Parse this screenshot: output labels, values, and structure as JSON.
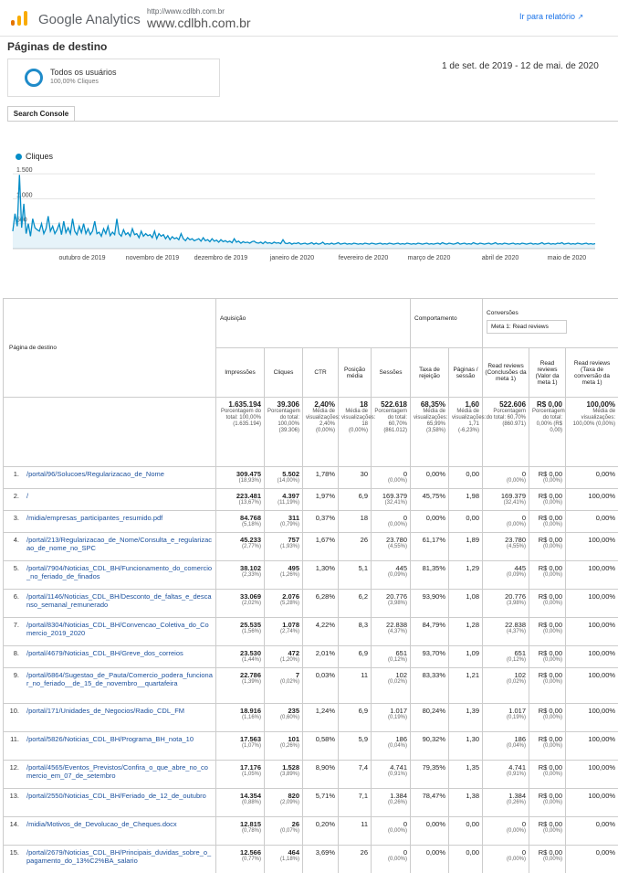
{
  "header": {
    "product": "Google Analytics",
    "site_small": "http://www.cdlbh.com.br",
    "site_big": "www.cdlbh.com.br",
    "report_link": "Ir para relatório",
    "brand_colors": [
      "#f9ab00",
      "#e37400"
    ]
  },
  "page_title": "Páginas de destino",
  "segment": {
    "name": "Todos os usuários",
    "pct": "100,00% Cliques"
  },
  "date_range": "1 de set. de 2019 - 12 de mai. de 2020",
  "tab": "Search Console",
  "chart_data": {
    "type": "line",
    "series": [
      {
        "name": "Cliques",
        "color": "#058dc7",
        "values": [
          350,
          700,
          450,
          1480,
          420,
          900,
          300,
          500,
          250,
          600,
          420,
          380,
          350,
          500,
          300,
          400,
          650,
          350,
          450,
          300,
          380,
          500,
          280,
          550,
          320,
          420,
          300,
          600,
          350,
          280,
          450,
          320,
          500,
          300,
          400,
          280,
          350,
          550,
          300,
          330,
          250,
          400,
          300,
          450,
          260,
          330,
          280,
          600,
          300,
          250,
          380,
          280,
          320,
          250,
          400,
          280,
          300,
          220,
          350,
          250,
          300,
          260,
          280,
          220,
          350,
          200,
          300,
          250,
          280,
          200,
          260,
          180,
          240,
          200,
          220,
          180,
          300,
          200,
          160,
          220,
          180,
          200,
          160,
          180,
          200,
          150,
          220,
          160,
          180,
          140,
          200,
          150,
          170,
          130,
          180,
          140,
          160,
          130,
          150,
          120,
          200,
          130,
          150,
          110,
          140,
          120,
          130,
          110,
          140,
          150,
          120,
          110,
          130,
          100,
          140,
          110,
          120,
          100,
          130,
          110,
          120,
          100,
          180,
          110,
          100,
          120,
          90,
          110,
          100,
          120,
          90,
          100,
          110,
          90,
          100,
          120,
          90,
          110,
          90,
          100,
          130,
          90,
          100,
          90,
          110,
          90,
          100,
          120,
          90,
          100,
          110,
          90,
          100,
          90,
          110,
          100,
          90,
          100,
          90,
          110,
          100,
          90,
          110,
          100,
          90,
          100,
          110,
          90,
          100,
          90,
          110,
          100,
          90,
          100,
          110,
          90,
          100,
          90,
          110,
          100,
          90,
          100,
          90,
          110,
          100,
          90,
          100,
          110,
          90,
          100,
          90,
          100,
          110,
          90,
          120,
          100,
          90,
          110,
          100,
          90,
          100,
          120,
          90,
          100,
          110,
          90,
          100,
          90,
          120,
          100,
          90,
          110,
          100,
          90,
          100,
          110,
          90,
          100,
          120,
          90,
          100,
          90,
          110,
          100,
          90,
          100,
          110,
          90,
          100,
          90,
          110,
          100,
          90,
          100,
          110,
          90,
          100,
          90,
          100,
          120,
          90,
          100,
          110,
          90,
          100,
          90,
          110,
          100,
          120,
          90,
          100,
          110,
          90,
          100,
          90,
          110,
          100,
          90,
          100,
          110,
          90,
          100,
          90,
          100
        ]
      }
    ],
    "y_ticks": [
      "1.500",
      "1.000",
      "500"
    ],
    "ylim": [
      0,
      1650
    ],
    "x_ticks": [
      "outubro de 2019",
      "novembro de 2019",
      "dezembro de 2019",
      "janeiro de 2020",
      "fevereiro de 2020",
      "março de 2020",
      "abril de 2020",
      "maio de 2020"
    ]
  },
  "table": {
    "dim_header": "Página de destino",
    "groups": {
      "acq": "Aquisição",
      "beh": "Comportamento",
      "conv": "Conversões",
      "conv_select": "Meta 1: Read reviews"
    },
    "metrics": [
      "Impressões",
      "Cliques",
      "CTR",
      "Posição média",
      "Sessões",
      "Taxa de rejeição",
      "Páginas / sessão",
      "Read reviews (Conclusões da meta 1)",
      "Read reviews (Valor da meta 1)",
      "Read reviews (Taxa de conversão da meta 1)"
    ],
    "totals": [
      {
        "big": "1.635.194",
        "sm": "Porcentagem do total: 100,00% (1.635.194)"
      },
      {
        "big": "39.306",
        "sm": "Porcentagem do total: 100,00% (39.306)"
      },
      {
        "big": "2,40%",
        "sm": "Média de visualizações: 2,40% (0,00%)"
      },
      {
        "big": "18",
        "sm": "Média de visualizações: 18 (0,00%)"
      },
      {
        "big": "522.618",
        "sm": "Porcentagem do total: 60,70% (861.012)"
      },
      {
        "big": "68,35%",
        "sm": "Média de visualizações: 65,99% (3,58%)"
      },
      {
        "big": "1,60",
        "sm": "Média de visualizações: 1,71 (-6,23%)"
      },
      {
        "big": "522.606",
        "sm": "Porcentagem do total: 60,70% (860.971)"
      },
      {
        "big": "R$ 0,00",
        "sm": "Porcentagem do total: 0,00% (R$ 0,00)"
      },
      {
        "big": "100,00%",
        "sm": "Média de visualizações: 100,00% (0,00%)"
      }
    ],
    "rows": [
      {
        "n": "1.",
        "page": "/portal/96/Solucoes/Regularizacao_de_Nome",
        "imp": "309.475",
        "imp_p": "(18,93%)",
        "cli": "5.502",
        "cli_p": "(14,00%)",
        "ctr": "1,78%",
        "pos": "30",
        "ses": "0",
        "ses_p": "(0,00%)",
        "rej": "0,00%",
        "pag": "0,00",
        "rr": "0",
        "rr_p": "(0,00%)",
        "val": "R$ 0,00",
        "val_p": "(0,00%)",
        "tx": "0,00%"
      },
      {
        "n": "2.",
        "page": "/",
        "imp": "223.481",
        "imp_p": "(13,67%)",
        "cli": "4.397",
        "cli_p": "(11,19%)",
        "ctr": "1,97%",
        "pos": "6,9",
        "ses": "169.379",
        "ses_p": "(32,41%)",
        "rej": "45,75%",
        "pag": "1,98",
        "rr": "169.379",
        "rr_p": "(32,41%)",
        "val": "R$ 0,00",
        "val_p": "(0,00%)",
        "tx": "100,00%"
      },
      {
        "n": "3.",
        "page": "/midia/empresas_participantes_resumido.pdf",
        "imp": "84.768",
        "imp_p": "(5,18%)",
        "cli": "311",
        "cli_p": "(0,79%)",
        "ctr": "0,37%",
        "pos": "18",
        "ses": "0",
        "ses_p": "(0,00%)",
        "rej": "0,00%",
        "pag": "0,00",
        "rr": "0",
        "rr_p": "(0,00%)",
        "val": "R$ 0,00",
        "val_p": "(0,00%)",
        "tx": "0,00%"
      },
      {
        "n": "4.",
        "page": "/portal/213/Regularizacao_de_Nome/Consulta_e_regularizacao_de_nome_no_SPC",
        "imp": "45.233",
        "imp_p": "(2,77%)",
        "cli": "757",
        "cli_p": "(1,93%)",
        "ctr": "1,67%",
        "pos": "26",
        "ses": "23.780",
        "ses_p": "(4,55%)",
        "rej": "61,17%",
        "pag": "1,89",
        "rr": "23.780",
        "rr_p": "(4,55%)",
        "val": "R$ 0,00",
        "val_p": "(0,00%)",
        "tx": "100,00%"
      },
      {
        "n": "5.",
        "page": "/portal/7904/Noticias_CDL_BH/Funcionamento_do_comercio_no_feriado_de_finados",
        "imp": "38.102",
        "imp_p": "(2,33%)",
        "cli": "495",
        "cli_p": "(1,26%)",
        "ctr": "1,30%",
        "pos": "5,1",
        "ses": "445",
        "ses_p": "(0,09%)",
        "rej": "81,35%",
        "pag": "1,29",
        "rr": "445",
        "rr_p": "(0,09%)",
        "val": "R$ 0,00",
        "val_p": "(0,00%)",
        "tx": "100,00%"
      },
      {
        "n": "6.",
        "page": "/portal/1146/Noticias_CDL_BH/Desconto_de_faltas_e_descanso_semanal_remunerado",
        "imp": "33.069",
        "imp_p": "(2,02%)",
        "cli": "2.076",
        "cli_p": "(5,28%)",
        "ctr": "6,28%",
        "pos": "6,2",
        "ses": "20.776",
        "ses_p": "(3,98%)",
        "rej": "93,90%",
        "pag": "1,08",
        "rr": "20.776",
        "rr_p": "(3,98%)",
        "val": "R$ 0,00",
        "val_p": "(0,00%)",
        "tx": "100,00%"
      },
      {
        "n": "7.",
        "page": "/portal/8304/Noticias_CDL_BH/Convencao_Coletiva_do_Comercio_2019_2020",
        "imp": "25.535",
        "imp_p": "(1,56%)",
        "cli": "1.078",
        "cli_p": "(2,74%)",
        "ctr": "4,22%",
        "pos": "8,3",
        "ses": "22.838",
        "ses_p": "(4,37%)",
        "rej": "84,79%",
        "pag": "1,28",
        "rr": "22.838",
        "rr_p": "(4,37%)",
        "val": "R$ 0,00",
        "val_p": "(0,00%)",
        "tx": "100,00%"
      },
      {
        "n": "8.",
        "page": "/portal/4679/Noticias_CDL_BH/Greve_dos_correios",
        "imp": "23.530",
        "imp_p": "(1,44%)",
        "cli": "472",
        "cli_p": "(1,20%)",
        "ctr": "2,01%",
        "pos": "6,9",
        "ses": "651",
        "ses_p": "(0,12%)",
        "rej": "93,70%",
        "pag": "1,09",
        "rr": "651",
        "rr_p": "(0,12%)",
        "val": "R$ 0,00",
        "val_p": "(0,00%)",
        "tx": "100,00%"
      },
      {
        "n": "9.",
        "page": "/portal/6864/Sugestao_de_Pauta/Comercio_podera_funcionar_no_feriado__de_15_de_novembro__quartafeira",
        "imp": "22.786",
        "imp_p": "(1,39%)",
        "cli": "7",
        "cli_p": "(0,02%)",
        "ctr": "0,03%",
        "pos": "11",
        "ses": "102",
        "ses_p": "(0,02%)",
        "rej": "83,33%",
        "pag": "1,21",
        "rr": "102",
        "rr_p": "(0,02%)",
        "val": "R$ 0,00",
        "val_p": "(0,00%)",
        "tx": "100,00%"
      },
      {
        "n": "10.",
        "page": "/portal/171/Unidades_de_Negocios/Radio_CDL_FM",
        "imp": "18.916",
        "imp_p": "(1,16%)",
        "cli": "235",
        "cli_p": "(0,60%)",
        "ctr": "1,24%",
        "pos": "6,9",
        "ses": "1.017",
        "ses_p": "(0,19%)",
        "rej": "80,24%",
        "pag": "1,39",
        "rr": "1.017",
        "rr_p": "(0,19%)",
        "val": "R$ 0,00",
        "val_p": "(0,00%)",
        "tx": "100,00%"
      },
      {
        "n": "11.",
        "page": "/portal/5826/Noticias_CDL_BH/Programa_BH_nota_10",
        "imp": "17.563",
        "imp_p": "(1,07%)",
        "cli": "101",
        "cli_p": "(0,26%)",
        "ctr": "0,58%",
        "pos": "5,9",
        "ses": "186",
        "ses_p": "(0,04%)",
        "rej": "90,32%",
        "pag": "1,30",
        "rr": "186",
        "rr_p": "(0,04%)",
        "val": "R$ 0,00",
        "val_p": "(0,00%)",
        "tx": "100,00%"
      },
      {
        "n": "12.",
        "page": "/portal/4565/Eventos_Previstos/Confira_o_que_abre_no_comercio_em_07_de_setembro",
        "imp": "17.176",
        "imp_p": "(1,05%)",
        "cli": "1.528",
        "cli_p": "(3,89%)",
        "ctr": "8,90%",
        "pos": "7,4",
        "ses": "4.741",
        "ses_p": "(0,91%)",
        "rej": "79,35%",
        "pag": "1,35",
        "rr": "4.741",
        "rr_p": "(0,91%)",
        "val": "R$ 0,00",
        "val_p": "(0,00%)",
        "tx": "100,00%"
      },
      {
        "n": "13.",
        "page": "/portal/2550/Noticias_CDL_BH/Feriado_de_12_de_outubro",
        "imp": "14.354",
        "imp_p": "(0,88%)",
        "cli": "820",
        "cli_p": "(2,09%)",
        "ctr": "5,71%",
        "pos": "7,1",
        "ses": "1.384",
        "ses_p": "(0,26%)",
        "rej": "78,47%",
        "pag": "1,38",
        "rr": "1.384",
        "rr_p": "(0,26%)",
        "val": "R$ 0,00",
        "val_p": "(0,00%)",
        "tx": "100,00%"
      },
      {
        "n": "14.",
        "page": "/midia/Motivos_de_Devolucao_de_Cheques.docx",
        "imp": "12.815",
        "imp_p": "(0,78%)",
        "cli": "26",
        "cli_p": "(0,07%)",
        "ctr": "0,20%",
        "pos": "11",
        "ses": "0",
        "ses_p": "(0,00%)",
        "rej": "0,00%",
        "pag": "0,00",
        "rr": "0",
        "rr_p": "(0,00%)",
        "val": "R$ 0,00",
        "val_p": "(0,00%)",
        "tx": "0,00%"
      },
      {
        "n": "15.",
        "page": "/portal/2679/Noticias_CDL_BH/Principais_duvidas_sobre_o_pagamento_do_13%C2%BA_salario",
        "imp": "12.566",
        "imp_p": "(0,77%)",
        "cli": "464",
        "cli_p": "(1,18%)",
        "ctr": "3,69%",
        "pos": "26",
        "ses": "0",
        "ses_p": "(0,00%)",
        "rej": "0,00%",
        "pag": "0,00",
        "rr": "0",
        "rr_p": "(0,00%)",
        "val": "R$ 0,00",
        "val_p": "(0,00%)",
        "tx": "0,00%"
      }
    ]
  }
}
